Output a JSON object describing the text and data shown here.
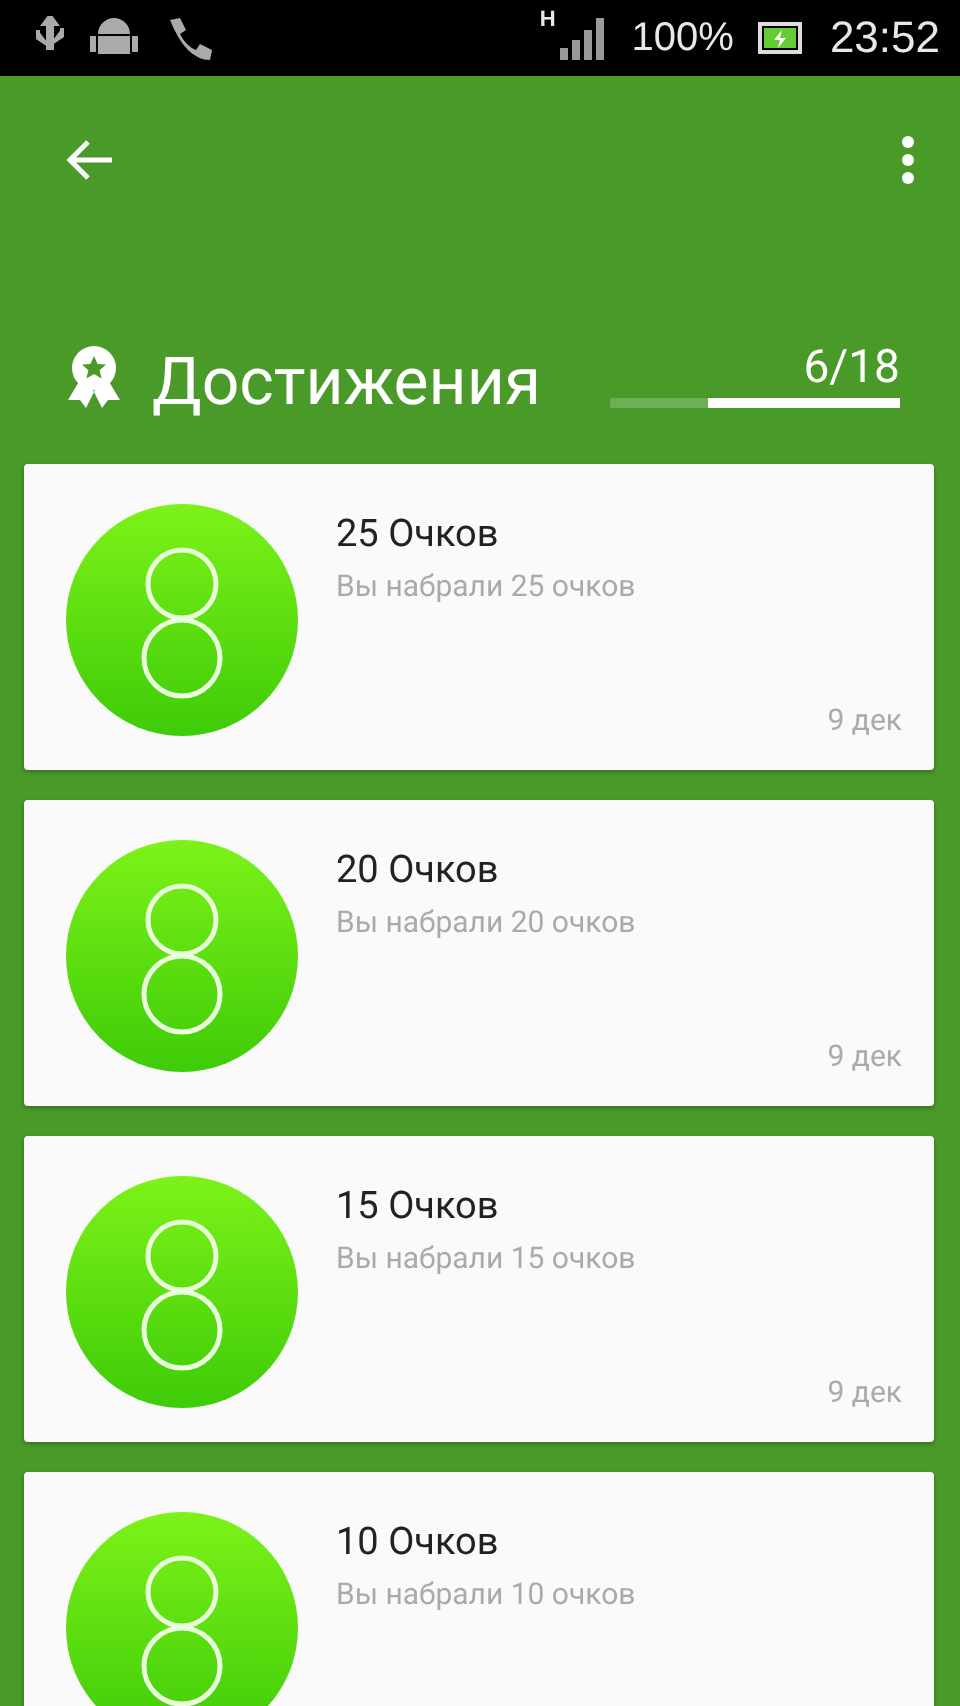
{
  "status_bar": {
    "network": "H",
    "battery": "100%",
    "time": "23:52"
  },
  "header": {
    "title": "Достижения",
    "progress": "6/18",
    "level": 0.66
  },
  "achievements": [
    {
      "title": "25 Очков",
      "description": "Вы набрали 25 очков",
      "date": "9 дек"
    },
    {
      "title": "20 Очков",
      "description": "Вы набрали 20 очков",
      "date": "9 дек"
    },
    {
      "title": "15 Очков",
      "description": "Вы набрали 15 очков",
      "date": "9 дек"
    },
    {
      "title": "10 Очков",
      "description": "Вы набрали 10 очков"
    }
  ]
}
